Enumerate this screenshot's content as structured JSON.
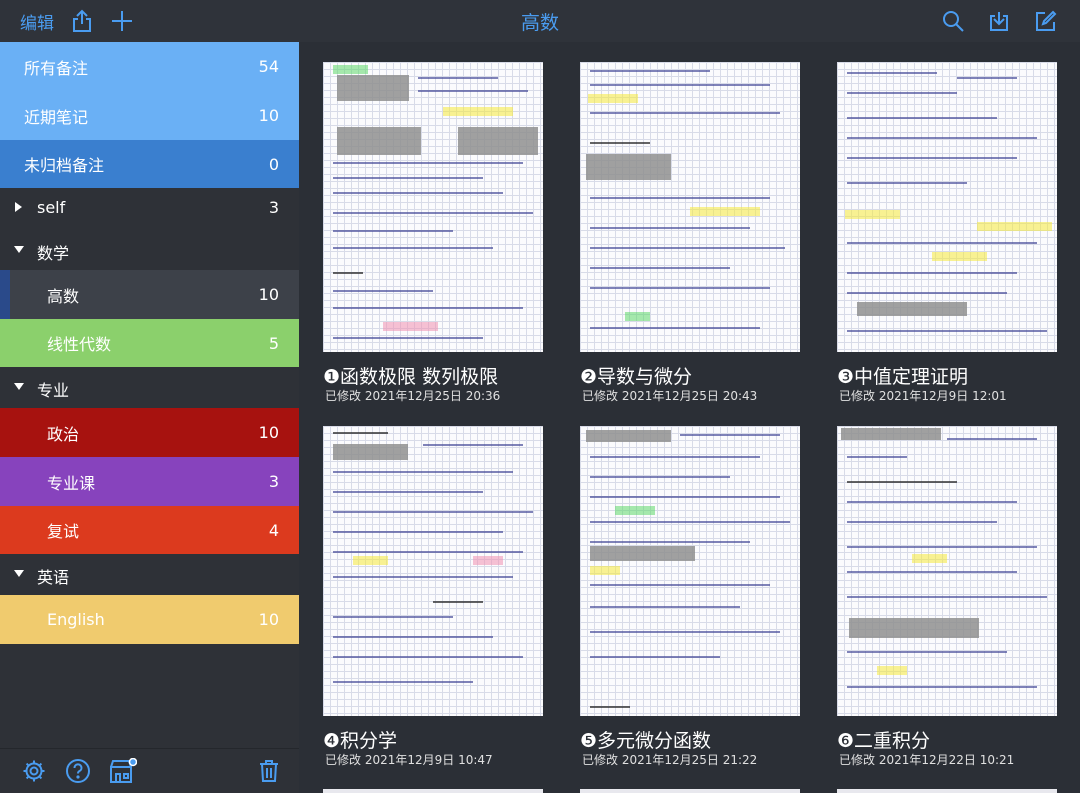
{
  "toolbar": {
    "edit_label": "编辑",
    "title": "高数",
    "accent": "#4a9cf0"
  },
  "sidebar": {
    "smart_items": [
      {
        "label": "所有备注",
        "count": "54",
        "color": "#6ab0f5"
      },
      {
        "label": "近期笔记",
        "count": "10",
        "color": "#6ab0f5"
      },
      {
        "label": "未归档备注",
        "count": "0",
        "color": "#3a7fcf"
      }
    ],
    "groups": {
      "self": {
        "label": "self",
        "count": "3",
        "expanded": false
      },
      "math": {
        "label": "数学",
        "expanded": true
      },
      "major": {
        "label": "专业",
        "expanded": true
      },
      "english": {
        "label": "英语",
        "expanded": true
      }
    },
    "notebooks": {
      "gaoshu": {
        "label": "高数",
        "count": "10",
        "color": "#3d4149",
        "selected": true
      },
      "xiandai": {
        "label": "线性代数",
        "count": "5",
        "color": "#8bd06c"
      },
      "zhengzhi": {
        "label": "政治",
        "count": "10",
        "color": "#a7120f"
      },
      "zhuanyeke": {
        "label": "专业课",
        "count": "3",
        "color": "#8743bd"
      },
      "fushi": {
        "label": "复试",
        "count": "4",
        "color": "#dc3a1e"
      },
      "english": {
        "label": "English",
        "count": "10",
        "color": "#f0cb6e"
      }
    },
    "bottom_icons": [
      "gear-icon",
      "help-icon",
      "store-icon",
      "trash-icon"
    ]
  },
  "notes": [
    {
      "title": "❶函数极限 数列极限",
      "date": "已修改 2021年12月25日 20:36"
    },
    {
      "title": "❷导数与微分",
      "date": "已修改 2021年12月25日 20:43"
    },
    {
      "title": "❸中值定理证明",
      "date": "已修改 2021年12月9日 12:01"
    },
    {
      "title": "❹积分学",
      "date": "已修改 2021年12月9日 10:47"
    },
    {
      "title": "❺多元微分函数",
      "date": "已修改 2021年12月25日 21:22"
    },
    {
      "title": "❻二重积分",
      "date": "已修改 2021年12月22日 10:21"
    }
  ]
}
